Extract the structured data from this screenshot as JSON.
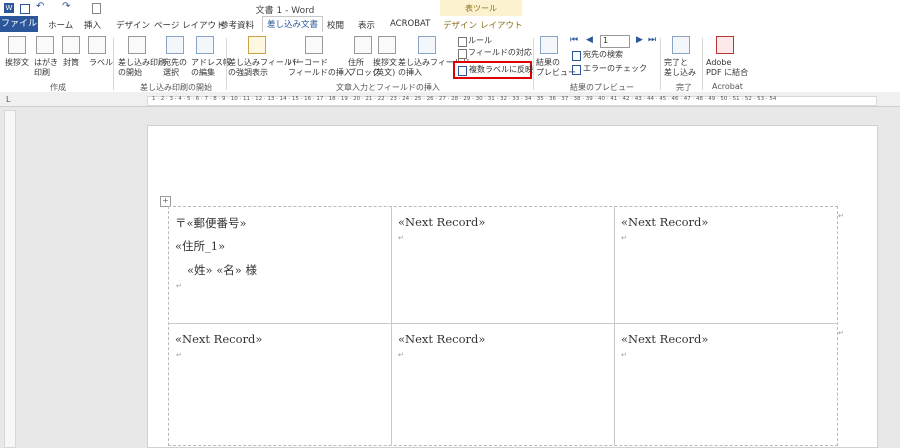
{
  "window": {
    "title": "文書 1 - Word",
    "context_header": "表ツール"
  },
  "tabs": [
    "ファイル",
    "ホーム",
    "挿入",
    "デザイン",
    "ページ レイアウト",
    "参考資料",
    "差し込み文書",
    "校閲",
    "表示",
    "ACROBAT",
    "デザイン",
    "レイアウト"
  ],
  "ribbon": {
    "create": {
      "items": [
        "挨拶文",
        "はがき\n印刷",
        "封筒",
        "ラベル"
      ],
      "group": "作成"
    },
    "start": {
      "items": [
        "差し込み印刷\nの開始",
        "宛先の\n選択",
        "アドレス帳\nの編集"
      ],
      "group": "差し込み印刷の開始"
    },
    "fields": {
      "items": [
        "差し込みフィールド\nの強調表示",
        "バーコード\nフィールドの挿入",
        "住所\nブロック",
        "挨拶文\n(英文)",
        "差し込みフィールド\nの挿入"
      ],
      "rules": "ルール",
      "match": "フィールドの対応",
      "update_labels": "複数ラベルに反映",
      "group": "文章入力とフィールドの挿入"
    },
    "preview": {
      "items": [
        "結果の\nプレビュー"
      ],
      "record": "1",
      "find": "宛先の検索",
      "check": "エラーのチェック",
      "group": "結果のプレビュー"
    },
    "finish": {
      "items": [
        "完了と\n差し込み"
      ],
      "group": "完了"
    },
    "acrobat": {
      "items": [
        "Adobe\nPDF に結合"
      ],
      "group": "Acrobat"
    }
  },
  "ruler": "1 · 2 · 3 · 4 · 5 · 6 · 7 · 8 · 9 · 10 · 11 · 12 · 13 · 14 · 15 · 16 · 17 · 18 · 19 · 20 · 21 · 22 · 23 · 24 · 25 · 26 · 27 · 28 · 29 · 30 · 31 · 32 · 33 · 34 · 35 · 36 · 37 · 38 · 39 · 40 · 41 · 42 · 43 · 44 · 45 · 46 · 47 · 48 · 49 · 50 · 51 · 52 · 53 · 54",
  "document": {
    "first_label": {
      "line1": "〒«郵便番号»",
      "line2": "«住所_1»",
      "line3": "«姓» «名» 様"
    },
    "next_record": "«Next Record»"
  }
}
